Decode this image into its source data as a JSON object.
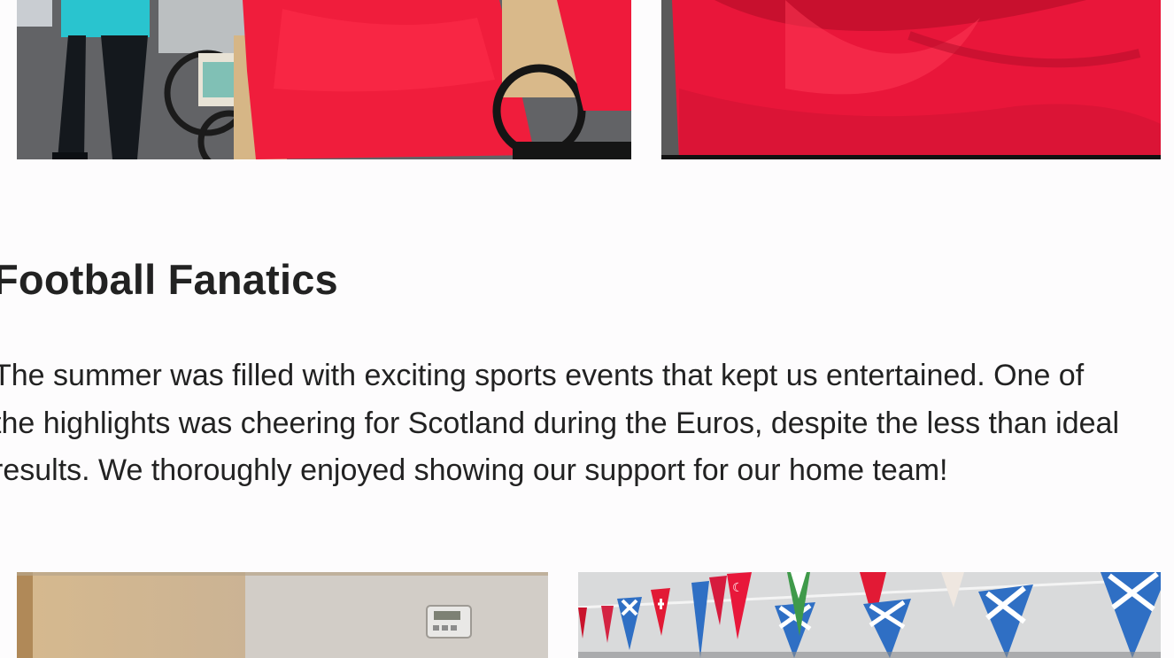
{
  "section": {
    "heading": "Football Fanatics",
    "paragraph_lines": [
      "The summer was filled with exciting sports events that kept us entertained. One of",
      "the highlights was cheering for Scotland during the Euros, despite the less than ideal",
      "results. We thoroughly enjoyed showing our support for our home team!"
    ]
  },
  "photos": {
    "top_left": "photo-red-cover-bike",
    "top_right": "photo-red-fabric",
    "bottom_left": "photo-room-wall",
    "bottom_right": "photo-flag-bunting"
  },
  "colors": {
    "accent_red": "#e8173a",
    "saltire_blue": "#2f6fc4",
    "text": "#222222",
    "background": "#fdfcfd"
  }
}
